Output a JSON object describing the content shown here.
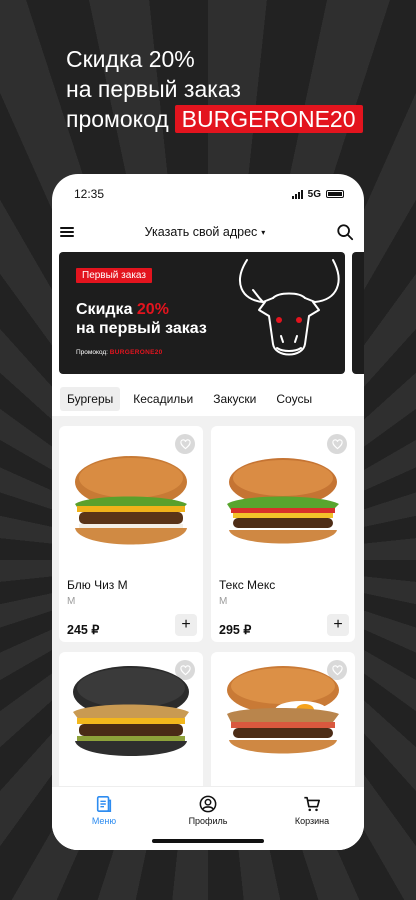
{
  "promo": {
    "line1": "Скидка 20%",
    "line2": "на первый заказ",
    "line3_text": "промокод",
    "code": "BURGERONE20"
  },
  "status_bar": {
    "time": "12:35",
    "network": "5G"
  },
  "header": {
    "address_label": "Указать свой адрес"
  },
  "banner": {
    "tag": "Первый заказ",
    "title_prefix": "Скидка ",
    "title_highlight": "20%",
    "title_line2": "на первый заказ",
    "promo_label": "Промокод:",
    "promo_code": "BURGERONE20"
  },
  "tabs": [
    {
      "label": "Бургеры",
      "active": true
    },
    {
      "label": "Кесадильи",
      "active": false
    },
    {
      "label": "Закуски",
      "active": false
    },
    {
      "label": "Соусы",
      "active": false
    }
  ],
  "products": [
    {
      "name": "Блю Чиз М",
      "size": "М",
      "price": "245 ₽"
    },
    {
      "name": "Текс Мекс",
      "size": "М",
      "price": "295 ₽"
    },
    {
      "name": "",
      "size": "",
      "price": ""
    },
    {
      "name": "",
      "size": "",
      "price": ""
    }
  ],
  "bottom_nav": [
    {
      "label": "Меню",
      "icon": "menu-doc-icon",
      "active": true
    },
    {
      "label": "Профиль",
      "icon": "profile-icon",
      "active": false
    },
    {
      "label": "Корзина",
      "icon": "cart-icon",
      "active": false
    }
  ],
  "colors": {
    "accent_red": "#e3141e",
    "active_blue": "#2d8cf0",
    "background_dark": "#262626"
  }
}
